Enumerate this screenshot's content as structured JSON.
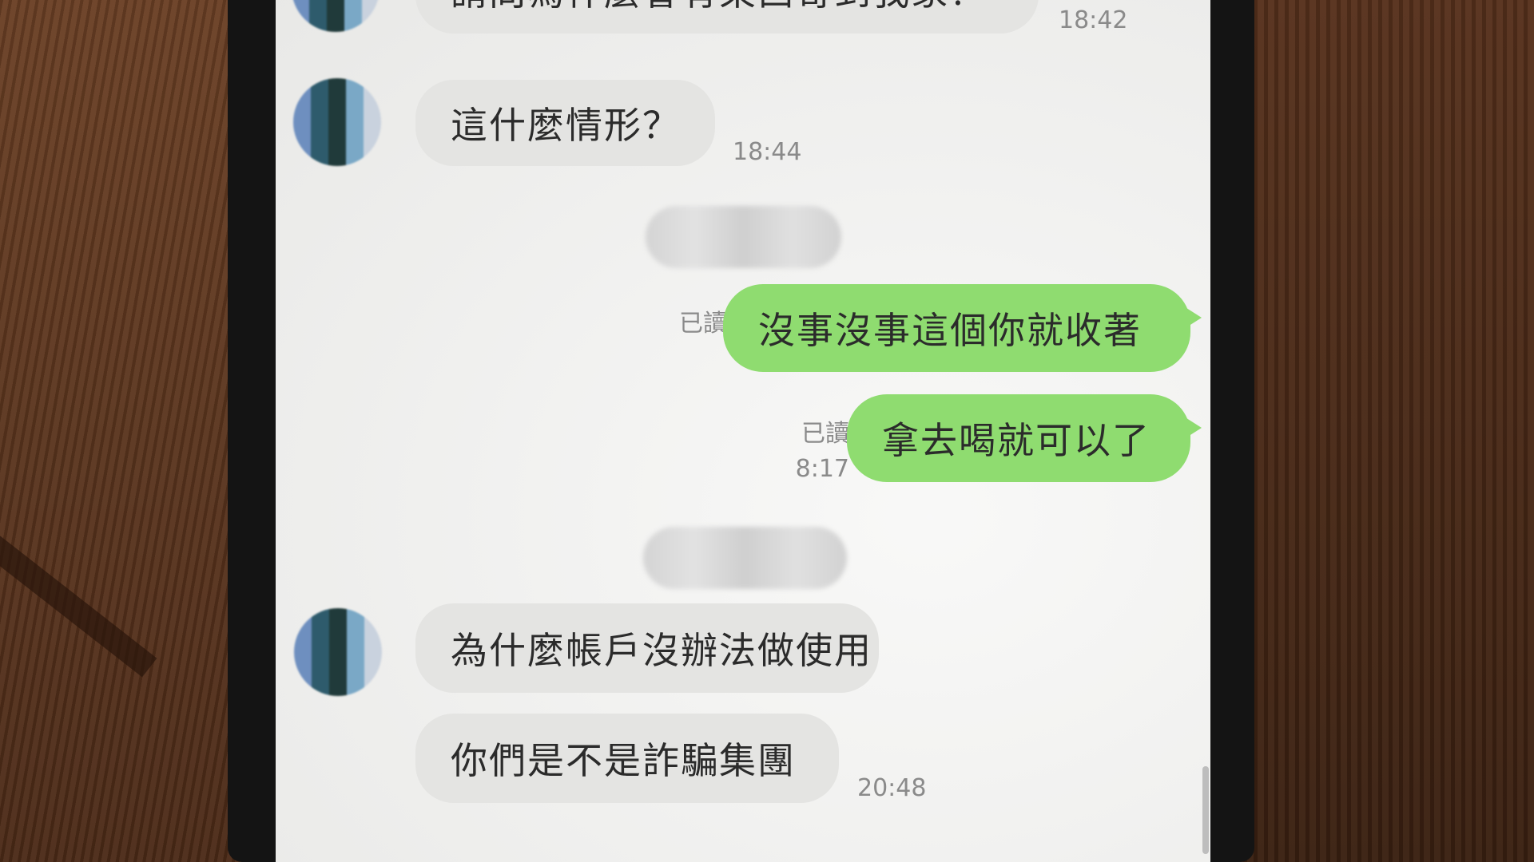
{
  "messages": {
    "top_partial": {
      "text": "請問為什麼會有東西寄到我家？",
      "time": "18:42"
    },
    "msg1": {
      "text": "這什麼情形？",
      "time": "18:44"
    },
    "out1": {
      "text": "沒事沒事這個你就收著",
      "status": "已讀"
    },
    "out2": {
      "text": "拿去喝就可以了",
      "status": "已讀",
      "time": "8:17"
    },
    "msg2": {
      "text": "為什麼帳戶沒辦法做使用"
    },
    "msg3": {
      "text": "你們是不是詐騙集團",
      "time": "20:48"
    }
  },
  "colors": {
    "outgoing_bubble": "#8fdc70",
    "incoming_bubble": "#e4e4e2",
    "screen_bg": "#f2f2f0"
  }
}
